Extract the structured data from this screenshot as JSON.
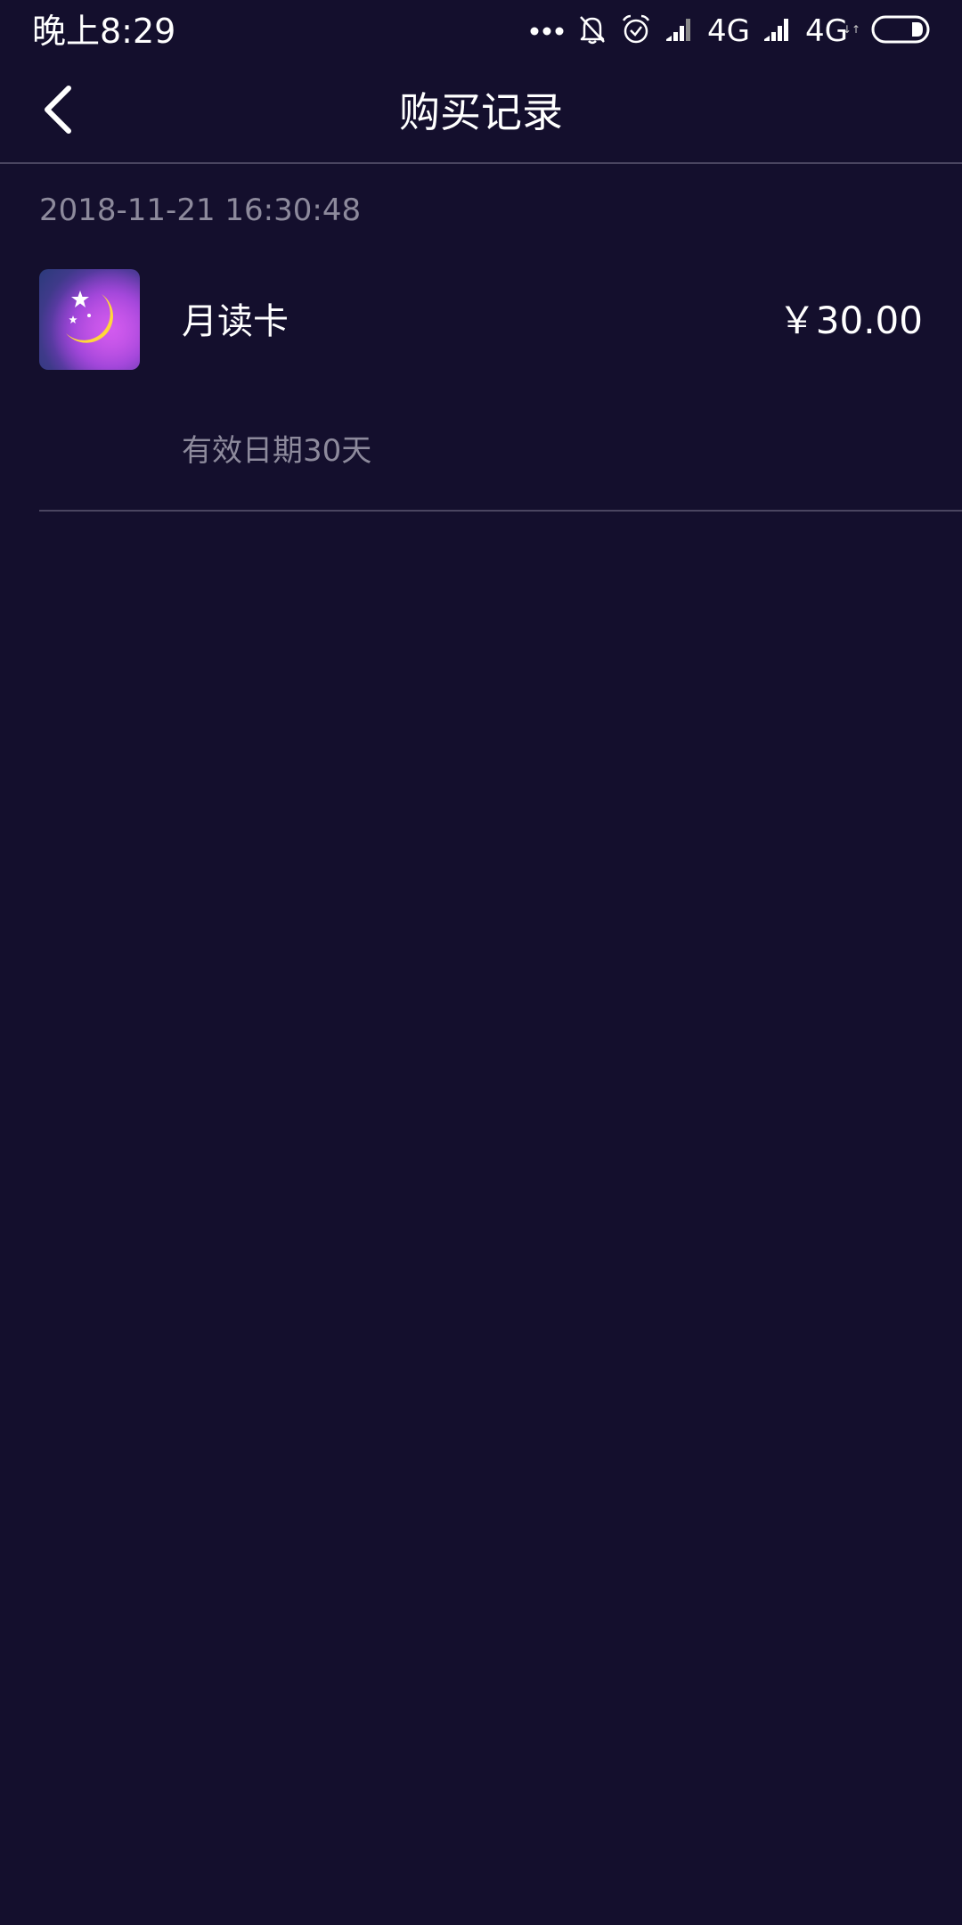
{
  "status_bar": {
    "time": "晚上8:29",
    "network_1": "4G",
    "network_2": "4G",
    "icons": [
      "dots-icon",
      "bell-off-icon",
      "alarm-icon",
      "signal-icon",
      "signal-icon",
      "battery-icon"
    ]
  },
  "header": {
    "title": "购买记录",
    "back_icon": "chevron-left-icon"
  },
  "records": [
    {
      "date": "2018-11-21 16:30:48",
      "thumbnail_icon": "moon-stars-icon",
      "name": "月读卡",
      "price": "￥30.00",
      "validity": "有效日期30天"
    }
  ],
  "colors": {
    "background": "#140f2d",
    "divider": "#4a4560",
    "secondary_text": "#8d8a9c",
    "moon": "#ffd83a",
    "thumb_purple": "#b04ad8"
  }
}
